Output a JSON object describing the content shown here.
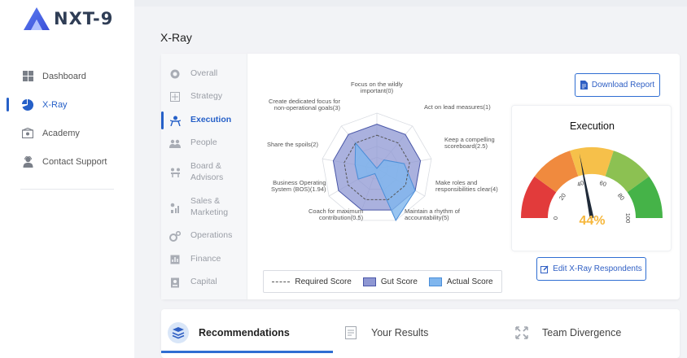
{
  "brand": {
    "name": "NXT-9"
  },
  "sidebar": {
    "items": [
      {
        "label": "Dashboard",
        "icon": "dashboard-grid-icon"
      },
      {
        "label": "X-Ray",
        "icon": "pie-chart-icon",
        "active": true
      },
      {
        "label": "Academy",
        "icon": "academy-icon"
      },
      {
        "label": "Contact Support",
        "icon": "support-agent-icon"
      }
    ]
  },
  "page": {
    "title": "X-Ray"
  },
  "categories": [
    {
      "label": "Overall",
      "icon": "overall-icon"
    },
    {
      "label": "Strategy",
      "icon": "strategy-icon"
    },
    {
      "label": "Execution",
      "icon": "execution-icon",
      "active": true
    },
    {
      "label": "People",
      "icon": "people-icon"
    },
    {
      "label": "Board &",
      "label2": "Advisors",
      "icon": "board-icon"
    },
    {
      "label": "Sales &",
      "label2": "Marketing",
      "icon": "sales-icon"
    },
    {
      "label": "Operations",
      "icon": "operations-icon"
    },
    {
      "label": "Finance",
      "icon": "finance-icon"
    },
    {
      "label": "Capital",
      "icon": "capital-icon"
    }
  ],
  "radar": {
    "axes": [
      {
        "line1": "Focus on the wildly",
        "line2": "important(0)"
      },
      {
        "line1": "Act on lead measures(1)",
        "line2": ""
      },
      {
        "line1": "Keep a compelling",
        "line2": "scoreboard(2.5)"
      },
      {
        "line1": "Make roles and",
        "line2": "responsibilities clear(4)"
      },
      {
        "line1": "Maintain a rhythm of",
        "line2": "accountability(5)"
      },
      {
        "line1": "Coach for maximum",
        "line2": "contribution(0.5)"
      },
      {
        "line1": "Business Operating",
        "line2": "System (BOS)(1.94)"
      },
      {
        "line1": "Share the spoils(2)",
        "line2": ""
      },
      {
        "line1": "Create dedicated focus for",
        "line2": "non-operational goals(3)"
      }
    ],
    "max": 5,
    "required_score": [
      3,
      3,
      3,
      3,
      3,
      3,
      3,
      3,
      3
    ],
    "gut_score": [
      4,
      4,
      4,
      4,
      4,
      4,
      4,
      4,
      4
    ],
    "actual_score": [
      0,
      1,
      2.5,
      4,
      5,
      0.5,
      1.94,
      2,
      3
    ],
    "colors": {
      "required": "#555555",
      "gut": "#8e97d3",
      "actual": "#7fb6ee"
    }
  },
  "legend": {
    "required": "Required Score",
    "gut": "Gut Score",
    "actual": "Actual Score"
  },
  "download": {
    "label": "Download Report",
    "icon": "document-icon"
  },
  "gauge": {
    "title": "Execution",
    "value": 44,
    "value_text": "44%",
    "min": 0,
    "max": 100,
    "ticks": [
      "0",
      "20",
      "40",
      "60",
      "80",
      "100"
    ],
    "colors": [
      "#e23b3b",
      "#f08a3e",
      "#f6c04a",
      "#8cc152",
      "#45b348"
    ]
  },
  "edit": {
    "label": "Edit X-Ray Respondents",
    "icon": "edit-icon"
  },
  "bottom_tabs": [
    {
      "label": "Recommendations",
      "icon": "recommendations-icon",
      "active": true
    },
    {
      "label": "Your Results",
      "icon": "results-icon"
    },
    {
      "label": "Team Divergence",
      "icon": "divergence-icon"
    }
  ]
}
